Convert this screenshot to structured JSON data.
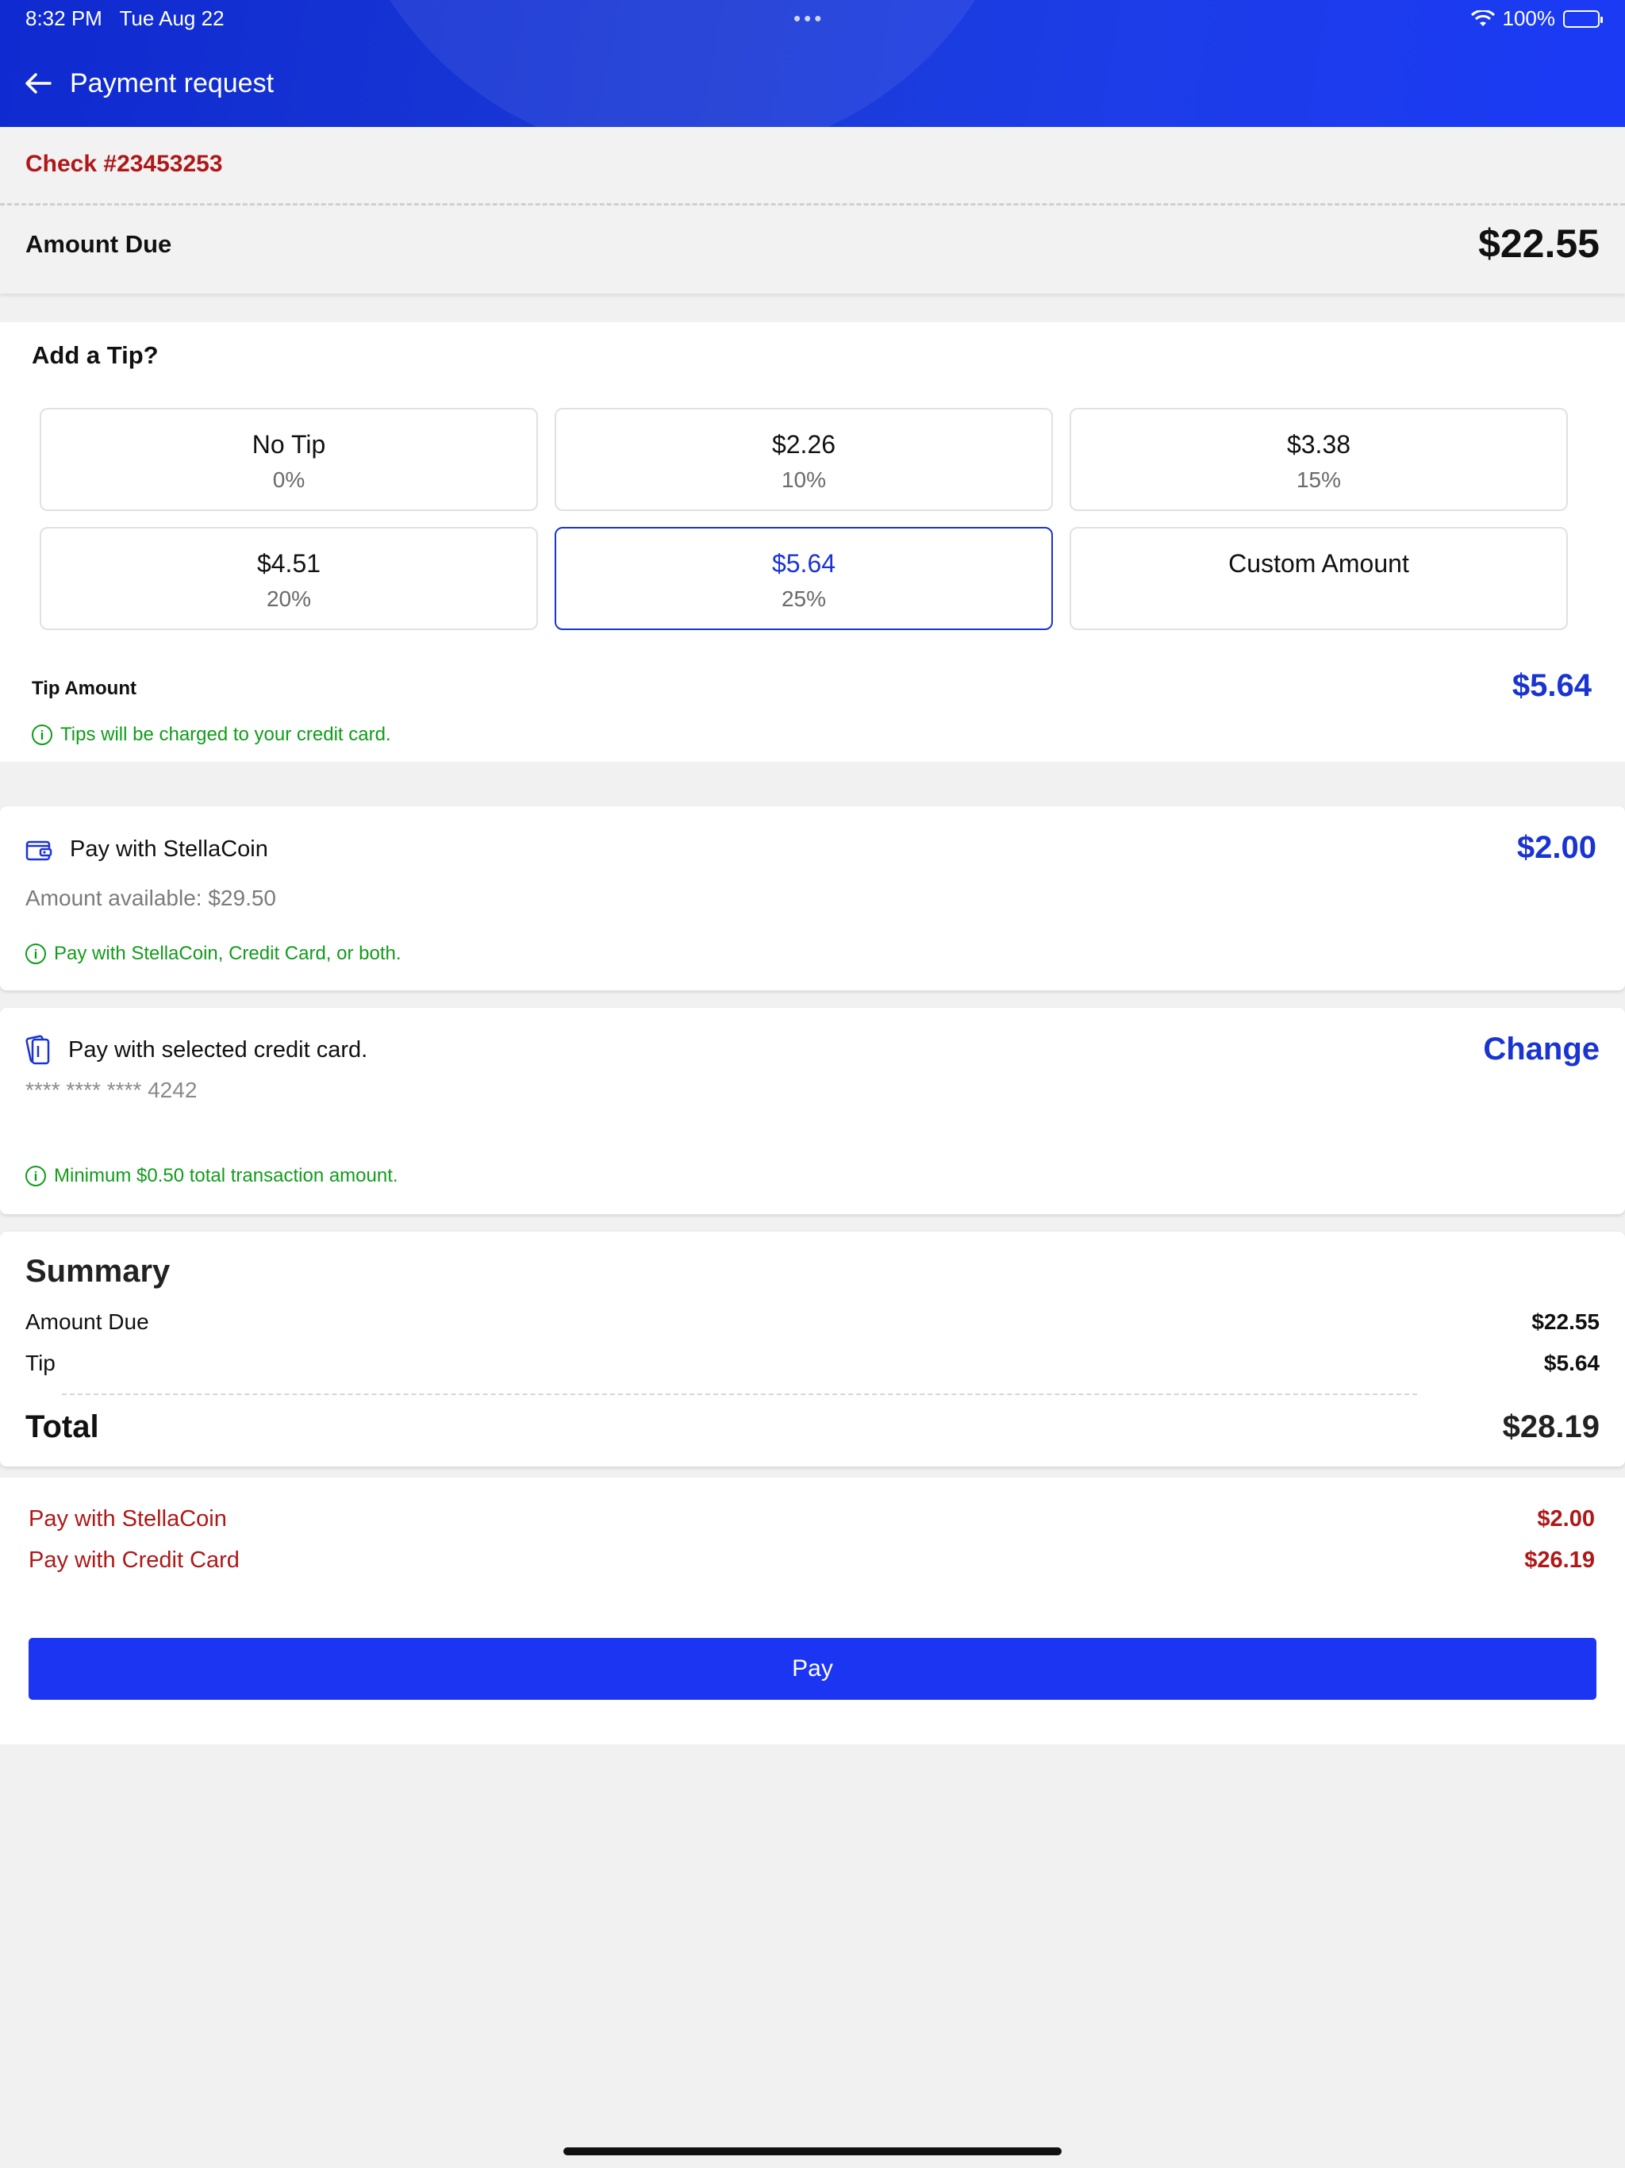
{
  "status_bar": {
    "time": "8:32 PM",
    "date": "Tue Aug 22",
    "dots": "•••",
    "battery_pct": "100%"
  },
  "header": {
    "title": "Payment request",
    "back_icon": "arrow-left-icon"
  },
  "check": {
    "number": "Check #23453253",
    "amount_due_label": "Amount Due",
    "amount_due_value": "$22.55"
  },
  "tip": {
    "heading": "Add a Tip?",
    "options": [
      {
        "main": "No Tip",
        "sub": "0%"
      },
      {
        "main": "$2.26",
        "sub": "10%"
      },
      {
        "main": "$3.38",
        "sub": "15%"
      },
      {
        "main": "$4.51",
        "sub": "20%"
      },
      {
        "main": "$5.64",
        "sub": "25%",
        "selected": true
      },
      {
        "main": "Custom Amount",
        "sub": ""
      }
    ],
    "amount_label": "Tip Amount",
    "amount_value": "$5.64",
    "note": "Tips will be charged to your credit card."
  },
  "stellacoin": {
    "label": "Pay with StellaCoin",
    "value": "$2.00",
    "available": "Amount available: $29.50",
    "note": "Pay with StellaCoin, Credit Card, or both."
  },
  "credit_card": {
    "label": "Pay with selected credit card.",
    "change_label": "Change",
    "masked_number": "**** **** **** 4242",
    "note": "Minimum $0.50 total transaction amount."
  },
  "summary": {
    "title": "Summary",
    "amount_due_label": "Amount Due",
    "amount_due_value": "$22.55",
    "tip_label": "Tip",
    "tip_value": "$5.64",
    "total_label": "Total",
    "total_value": "$28.19"
  },
  "payment_split": {
    "coin_label": "Pay with StellaCoin",
    "coin_value": "$2.00",
    "cc_label": "Pay with Credit Card",
    "cc_value": "$26.19"
  },
  "pay_button": "Pay",
  "colors": {
    "accent_blue": "#1a34d2",
    "pay_button": "#1c35f2",
    "danger_red": "#b01818",
    "info_green": "#119c1b"
  }
}
